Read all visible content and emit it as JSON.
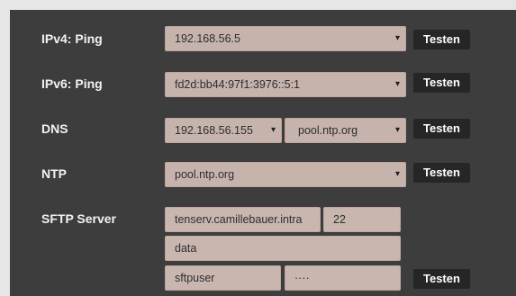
{
  "rows": [
    {
      "label": "IPv4: Ping",
      "select_value": "192.168.56.5",
      "button": "Testen"
    },
    {
      "label": "IPv6: Ping",
      "select_value": "fd2d:bb44:97f1:3976::5:1",
      "button": "Testen"
    },
    {
      "label": "DNS",
      "select_value": "192.168.56.155",
      "select_value_2": "pool.ntp.org",
      "button": "Testen"
    },
    {
      "label": "NTP",
      "select_value": "pool.ntp.org",
      "button": "Testen"
    },
    {
      "label": "SFTP Server",
      "host": "tenserv.camillebauer.intra",
      "port": "22",
      "path": "data",
      "user": "sftpuser",
      "password": "····",
      "button": "Testen"
    }
  ],
  "icons": {
    "dropdown_caret": "▾"
  }
}
